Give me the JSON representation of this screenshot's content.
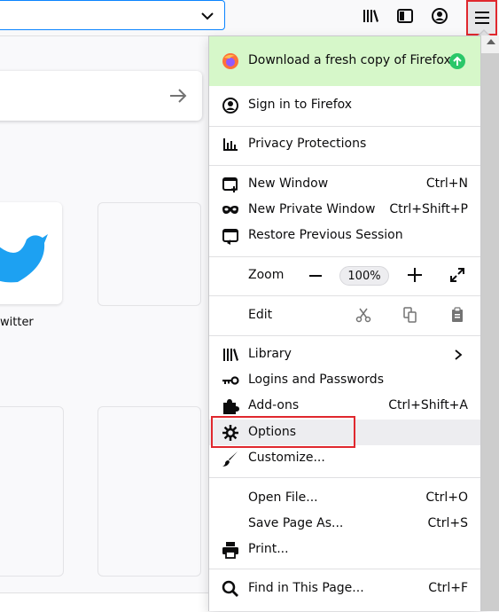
{
  "toolbar": {
    "icons": [
      "library-icon",
      "sidebars-icon",
      "account-icon",
      "hamburger-menu-icon"
    ]
  },
  "newtab": {
    "tile_label": "witter"
  },
  "panel": {
    "banner": {
      "label": "Download a fresh copy of Firefox"
    },
    "items": {
      "sign_in": {
        "label": "Sign in to Firefox"
      },
      "privacy": {
        "label": "Privacy Protections"
      },
      "new_window": {
        "label": "New Window",
        "shortcut": "Ctrl+N"
      },
      "new_private": {
        "label": "New Private Window",
        "shortcut": "Ctrl+Shift+P"
      },
      "restore": {
        "label": "Restore Previous Session"
      },
      "zoom": {
        "label": "Zoom",
        "value": "100%"
      },
      "edit": {
        "label": "Edit"
      },
      "library": {
        "label": "Library"
      },
      "logins": {
        "label": "Logins and Passwords"
      },
      "addons": {
        "label": "Add-ons",
        "shortcut": "Ctrl+Shift+A"
      },
      "options": {
        "label": "Options"
      },
      "customize": {
        "label": "Customize..."
      },
      "open_file": {
        "label": "Open File...",
        "shortcut": "Ctrl+O"
      },
      "save_page": {
        "label": "Save Page As...",
        "shortcut": "Ctrl+S"
      },
      "print": {
        "label": "Print..."
      },
      "find": {
        "label": "Find in This Page...",
        "shortcut": "Ctrl+F"
      }
    }
  },
  "colors": {
    "banner_bg": "#d6f7c9",
    "highlight_box": "#e0282e",
    "update_green": "#2ac769"
  }
}
